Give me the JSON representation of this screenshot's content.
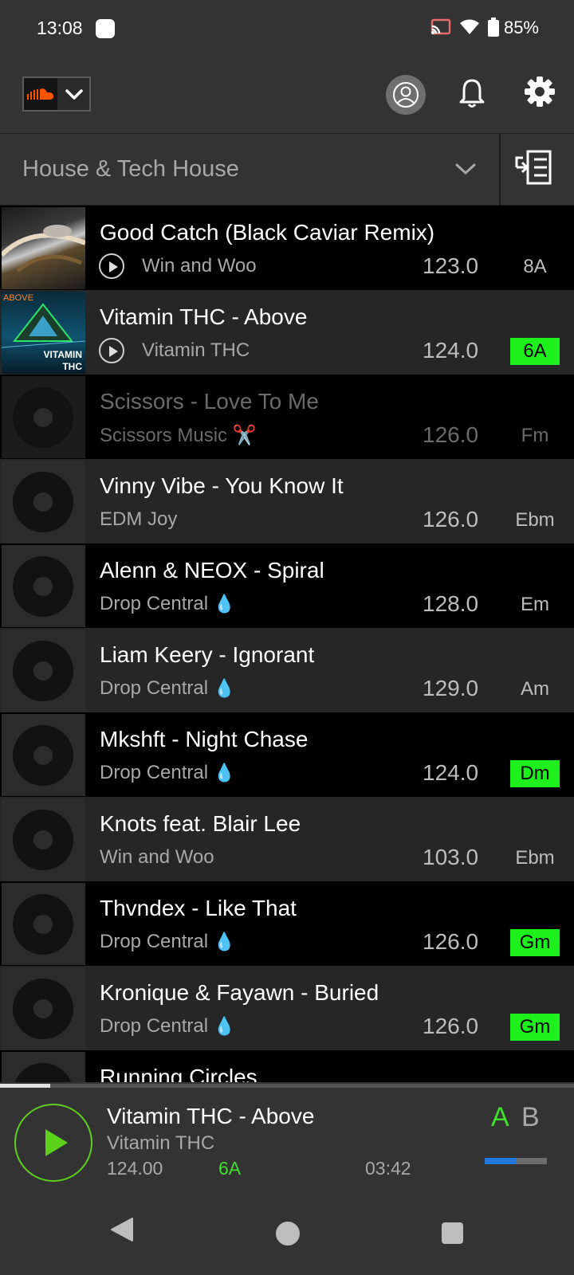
{
  "status_bar": {
    "time": "13:08",
    "battery": "85%",
    "icons": [
      "cast-icon",
      "wifi-icon",
      "battery-icon"
    ]
  },
  "topbar": {
    "source": "SoundCloud",
    "icons": [
      "soundcloud-icon",
      "chevron-down-icon",
      "account-icon",
      "bell-icon",
      "gear-icon"
    ]
  },
  "playlist": {
    "title": "House & Tech House"
  },
  "tracks": [
    {
      "title": "Good Catch (Black Caviar Remix)",
      "artist": "Win and Woo",
      "bpm": "123.0",
      "key": "8A",
      "key_highlight": false,
      "has_preview": true,
      "thumb": "art"
    },
    {
      "title": "Vitamin THC - Above",
      "artist": "Vitamin THC",
      "bpm": "124.0",
      "key": "6A",
      "key_highlight": true,
      "has_preview": true,
      "thumb": "art",
      "art_text_top": "ABOVE",
      "art_text_bottom1": "VITAMIN",
      "art_text_bottom2": "THC"
    },
    {
      "title": "Scissors - Love To Me",
      "artist": "Scissors Music ✂️",
      "bpm": "126.0",
      "key": "Fm",
      "key_highlight": false,
      "dimmed": true
    },
    {
      "title": "Vinny Vibe - You Know It",
      "artist": "EDM Joy",
      "bpm": "126.0",
      "key": "Ebm",
      "key_highlight": false
    },
    {
      "title": "Alenn & NEOX - Spiral",
      "artist": "Drop Central",
      "artist_emoji": "💧",
      "bpm": "128.0",
      "key": "Em",
      "key_highlight": false
    },
    {
      "title": "Liam Keery - Ignorant",
      "artist": "Drop Central",
      "artist_emoji": "💧",
      "bpm": "129.0",
      "key": "Am",
      "key_highlight": false
    },
    {
      "title": "Mkshft - Night Chase",
      "artist": "Drop Central",
      "artist_emoji": "💧",
      "bpm": "124.0",
      "key": "Dm",
      "key_highlight": true
    },
    {
      "title": "Knots feat. Blair Lee",
      "artist": "Win and Woo",
      "bpm": "103.0",
      "key": "Ebm",
      "key_highlight": false
    },
    {
      "title": "Thvndex - Like That",
      "artist": "Drop Central",
      "artist_emoji": "💧",
      "bpm": "126.0",
      "key": "Gm",
      "key_highlight": true
    },
    {
      "title": "Kronique & Fayawn - Buried",
      "artist": "Drop Central",
      "artist_emoji": "💧",
      "bpm": "126.0",
      "key": "Gm",
      "key_highlight": true
    },
    {
      "title": "Running Circles",
      "artist": "",
      "bpm": "",
      "key": "",
      "key_highlight": false
    }
  ],
  "player": {
    "progress": 0.088,
    "title": "Vitamin THC - Above",
    "artist": "Vitamin THC",
    "bpm": "124.00",
    "key": "6A",
    "duration": "03:42",
    "deck_a": "A",
    "deck_b": "B"
  },
  "colors": {
    "background": "#333333",
    "key_highlight": "#1ef01e",
    "accent_green": "#3fe02b",
    "deck_blue": "#1f7ad9"
  }
}
